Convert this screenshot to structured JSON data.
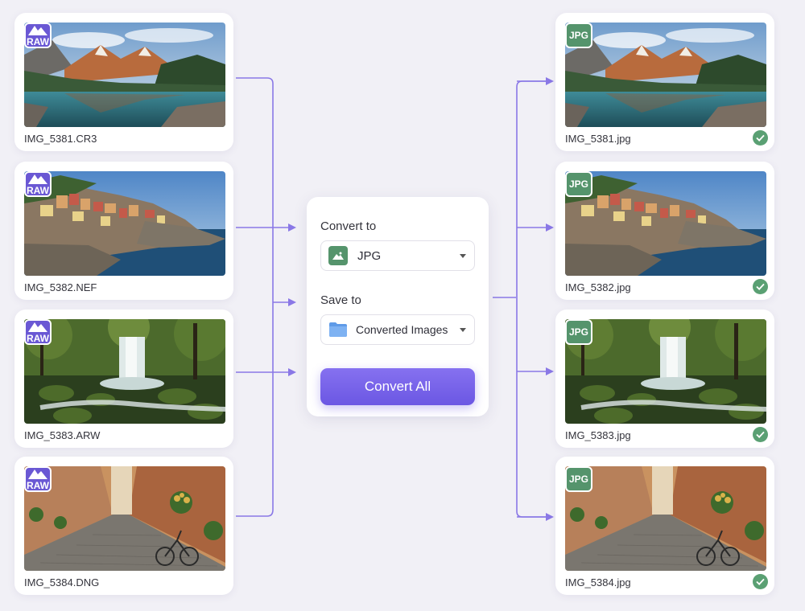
{
  "colors": {
    "accent": "#7b66e8",
    "raw_badge": "#6a58d4",
    "jpg_badge": "#55946c",
    "success": "#5aa073",
    "background": "#f1f0f6",
    "connector": "#8a78e6"
  },
  "sources": [
    {
      "badge": "RAW",
      "filename": "IMG_5381.CR3",
      "scene": "mountain-lake"
    },
    {
      "badge": "RAW",
      "filename": "IMG_5382.NEF",
      "scene": "cliff-village"
    },
    {
      "badge": "RAW",
      "filename": "IMG_5383.ARW",
      "scene": "forest-waterfall"
    },
    {
      "badge": "RAW",
      "filename": "IMG_5384.DNG",
      "scene": "cobblestone-alley"
    }
  ],
  "outputs": [
    {
      "badge": "JPG",
      "filename": "IMG_5381.jpg",
      "status_icon": "check-circle-icon"
    },
    {
      "badge": "JPG",
      "filename": "IMG_5382.jpg",
      "status_icon": "check-circle-icon"
    },
    {
      "badge": "JPG",
      "filename": "IMG_5383.jpg",
      "status_icon": "check-circle-icon"
    },
    {
      "badge": "JPG",
      "filename": "IMG_5384.jpg",
      "status_icon": "check-circle-icon"
    }
  ],
  "panel": {
    "convert_label": "Convert to",
    "format_value": "JPG",
    "format_icon": "image-icon",
    "save_label": "Save to",
    "folder_value": "Converted Images",
    "folder_icon": "folder-icon",
    "convert_button": "Convert All"
  }
}
